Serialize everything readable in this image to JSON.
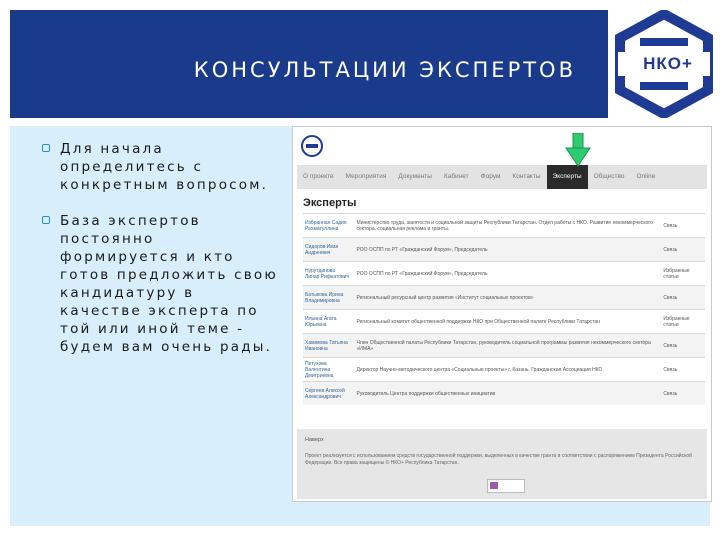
{
  "slide": {
    "title": "КОНСУЛЬТАЦИИ ЭКСПЕРТОВ",
    "bullets": [
      "Для начала определитесь с конкретным вопросом.",
      "База экспертов постоянно формируется и кто готов предложить свою кандидатуру в качестве эксперта по той или иной теме - будем вам очень рады."
    ]
  },
  "logo": {
    "text": "НКО+"
  },
  "screenshot": {
    "nav": [
      "О проекте",
      "Мероприятия",
      "Документы",
      "Кабинет",
      "Форум",
      "Контакты",
      "Эксперты",
      "Общество",
      "Online"
    ],
    "active_nav_index": 6,
    "heading": "Эксперты",
    "rows": [
      {
        "name": "Избранная Садия Рахматуллина",
        "desc": "Министерство труда, занятости и социальной защиты Республики Татарстан. Отдел работы с НКО. Развитие некоммерческого сектора, социальная реклама и гранты.",
        "link": "Связь"
      },
      {
        "name": "Сидоров Иван Андреевич",
        "desc": "РОО ОСПП по РТ «Гражданский Форум», Председатель",
        "link": "Связь"
      },
      {
        "name": "Нурутдинова Линар Рифкатович",
        "desc": "РОО ОСПП по РТ «Гражданский Форум», Председатель",
        "link": "Избранные статьи"
      },
      {
        "name": "Батыкова Ирина Владимировна",
        "desc": "Региональный ресурсный центр развития «Институт социальных проектов»",
        "link": "Связь"
      },
      {
        "name": "Ильина Агата Юрьевна",
        "desc": "Региональный комитет общественной поддержки НКО при Общественной палате Республики Татарстан",
        "link": "Избранные статьи"
      },
      {
        "name": "Хакимова Татьяна Ивановна",
        "desc": "Член Общественной палаты Республики Татарстан, руководитель социальной программы развития некоммерческого сектора «ИМА»",
        "link": "Связь"
      },
      {
        "name": "Петухова Валентина Дмитриевна",
        "desc": "Директор Научно-методического центра «Социальные проекты» г. Казань. Гражданская Ассоциация НКО",
        "link": "Связь"
      },
      {
        "name": "Сергеев Алексей Александрович",
        "desc": "Руководитель Центра поддержки общественных инициатив",
        "link": "Связь"
      }
    ],
    "footer_up": "Наверх",
    "footer_text": "Проект реализуется с использованием средств государственной поддержки, выделенных в качестве гранта в соответствии с распоряжением Президента Российской Федерации. Все права защищены © НКО+ Республика Татарстан."
  },
  "colors": {
    "header_bg": "#1a3a8c",
    "panel_bg": "#d9eefb",
    "arrow": "#2ecc71",
    "logo_blue": "#1f3a93"
  },
  "icons": {
    "bullet": "square-bullet-icon",
    "arrow": "down-arrow-icon",
    "logo": "nko-plus-logo"
  }
}
